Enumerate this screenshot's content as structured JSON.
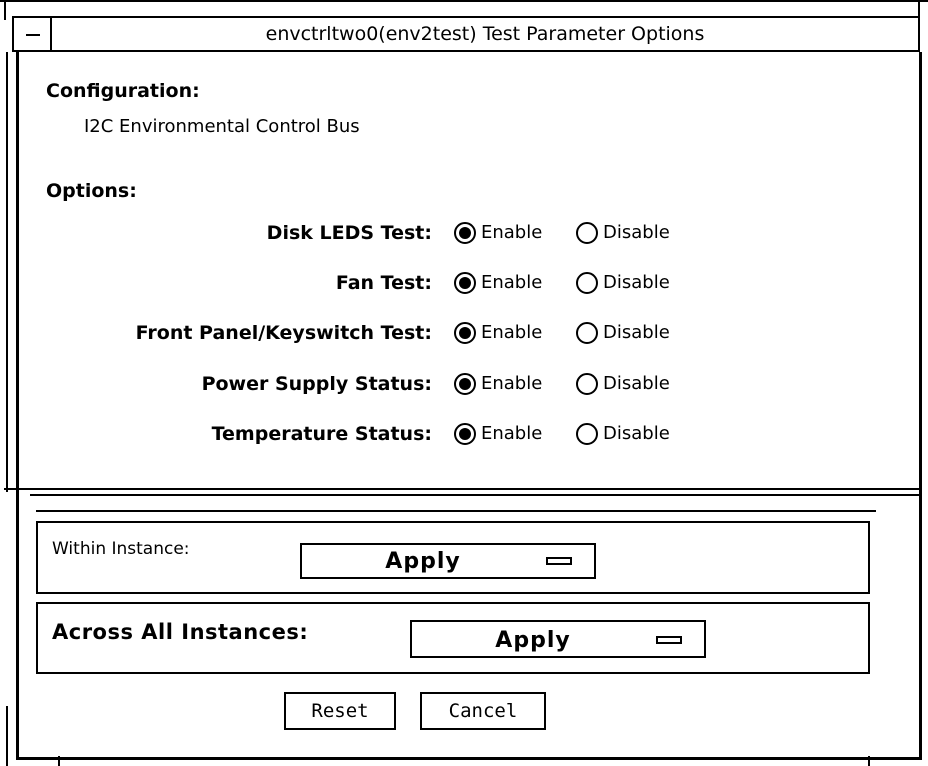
{
  "window": {
    "title": "envctrltwo0(env2test) Test Parameter Options"
  },
  "configuration": {
    "heading": "Configuration:",
    "value": "I2C Environmental Control Bus"
  },
  "options": {
    "heading": "Options:",
    "enable_label": "Enable",
    "disable_label": "Disable",
    "items": [
      {
        "label": "Disk LEDS Test:",
        "selected": "Enable"
      },
      {
        "label": "Fan Test:",
        "selected": "Enable"
      },
      {
        "label": "Front Panel/Keyswitch Test:",
        "selected": "Enable"
      },
      {
        "label": "Power Supply Status:",
        "selected": "Enable"
      },
      {
        "label": "Temperature Status:",
        "selected": "Enable"
      }
    ]
  },
  "within_instance": {
    "label": "Within Instance:",
    "button": "Apply"
  },
  "across_all": {
    "label": "Across All Instances:",
    "button": "Apply"
  },
  "buttons": {
    "reset": "Reset",
    "cancel": "Cancel"
  }
}
